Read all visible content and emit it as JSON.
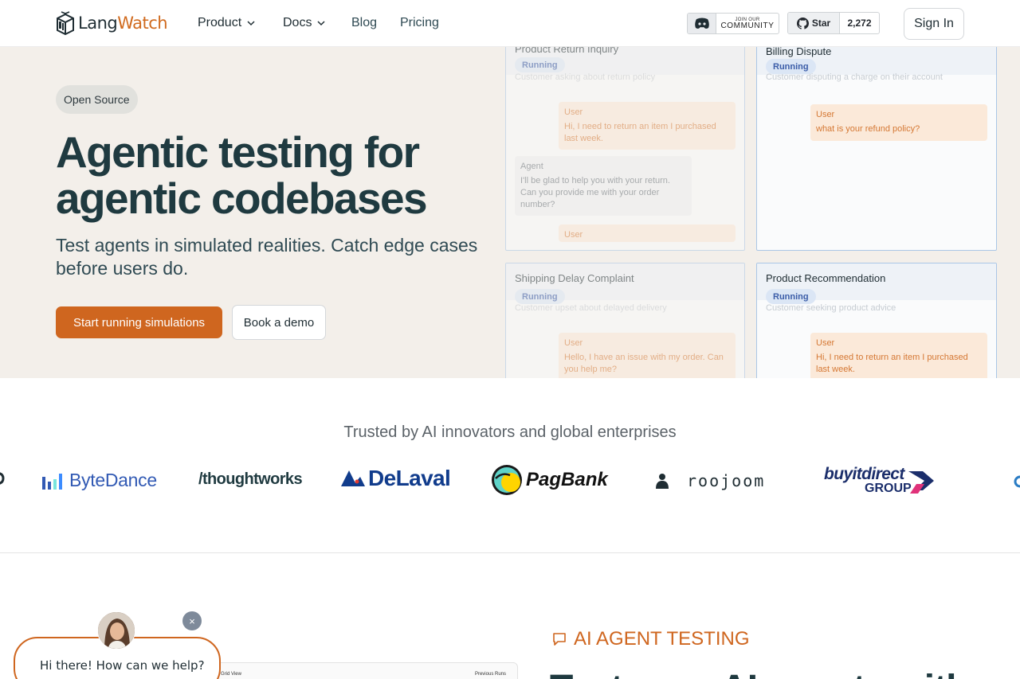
{
  "nav": {
    "brand_a": "Lang",
    "brand_b": "Watch",
    "links": [
      {
        "label": "Product",
        "dropdown": true
      },
      {
        "label": "Docs",
        "dropdown": true
      },
      {
        "label": "Blog",
        "dropdown": false
      },
      {
        "label": "Pricing",
        "dropdown": false
      }
    ],
    "discord_small": "JOIN OUR",
    "discord_big": "COMMUNITY",
    "github_star": "Star",
    "github_count": "2,272",
    "signin": "Sign In"
  },
  "hero": {
    "badge": "Open Source",
    "title": "Agentic testing for agentic codebases",
    "subtitle": "Test agents in simulated realities. Catch edge cases before users do.",
    "cta_primary": "Start running simulations",
    "cta_secondary": "Book a demo"
  },
  "simulations": [
    {
      "title": "Product Return Inquiry",
      "status": "Running",
      "description": "Customer asking about return policy",
      "messages": [
        {
          "role": "User",
          "text": "Hi, I need to return an item I purchased last week."
        },
        {
          "role": "Agent",
          "text": "I'll be glad to help you with your return. Can you provide me with your order number?"
        },
        {
          "role": "User",
          "text": ""
        }
      ]
    },
    {
      "title": "Billing Dispute",
      "status": "Running",
      "description": "Customer disputing a charge on their account",
      "messages": [
        {
          "role": "User",
          "text": "what is your refund policy?"
        }
      ]
    },
    {
      "title": "Shipping Delay Complaint",
      "status": "Running",
      "description": "Customer upset about delayed delivery",
      "messages": [
        {
          "role": "User",
          "text": "Hello, I have an issue with my order. Can you help me?"
        }
      ]
    },
    {
      "title": "Product Recommendation",
      "status": "Running",
      "description": "Customer seeking product advice",
      "messages": [
        {
          "role": "User",
          "text": "Hi, I need to return an item I purchased last week."
        }
      ]
    }
  ],
  "trusted": {
    "heading": "Trusted by AI innovators and global enterprises",
    "logos": [
      "ByteDance",
      "/thoughtworks",
      "DeLaval",
      "PagBank",
      "roojoom",
      "buyitdirect",
      "GROUP"
    ]
  },
  "chat": {
    "greeting": "Hi there! How can we help?",
    "close": "×"
  },
  "preview": {
    "left": "Grid View",
    "right": "Previous Runs"
  },
  "section": {
    "tag": "AI AGENT TESTING",
    "heading_peek": "Test your AI agents with"
  },
  "colors": {
    "accent": "#cf661f",
    "hero_bg": "#f3efea",
    "heading": "#1f3a40",
    "running_pill": "#3b5da8"
  }
}
